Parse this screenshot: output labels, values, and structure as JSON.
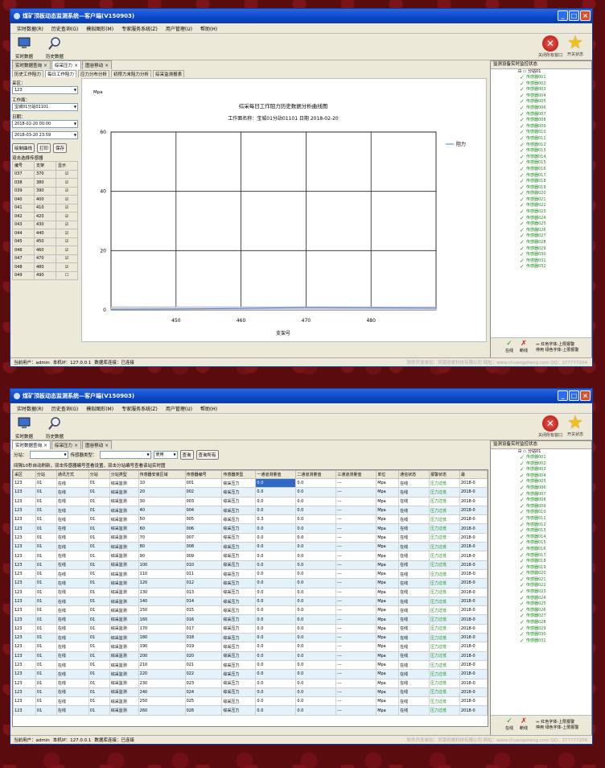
{
  "app": {
    "title": "煤矿顶板动态监测系统—客户端(V150903)",
    "menu": [
      "实时数据(R)",
      "历史查询(G)",
      "模拟图形(M)",
      "专家服务系统(Z)",
      "用户管理(U)",
      "帮助(H)"
    ],
    "toolbar": {
      "realtime": "实时数据",
      "history": "历史数据",
      "close_win": "关闭所有窗口",
      "switch_status": "开关状态"
    }
  },
  "status": {
    "user": "当前用户：admin",
    "ip": "本机IP：127.0.0.1",
    "db": "数据库连接：已连接",
    "faded": "软件开发单位：河南创晟科技有限公司  网址：www.chuangsheng.com  QQ：377777204"
  },
  "right_panel": {
    "title": "监测设备实时监控状态",
    "node": "分站01",
    "sensors": [
      "传感器001",
      "传感器002",
      "传感器003",
      "传感器004",
      "传感器005",
      "传感器006",
      "传感器007",
      "传感器008",
      "传感器009",
      "传感器010",
      "传感器011",
      "传感器012",
      "传感器013",
      "传感器014",
      "传感器015",
      "传感器016",
      "传感器017",
      "传感器018",
      "传感器019",
      "传感器020",
      "传感器021",
      "传感器022",
      "传感器023",
      "传感器024",
      "传感器025",
      "传感器026",
      "传感器027",
      "传感器028",
      "传感器029",
      "传感器030",
      "传感器031",
      "传感器032"
    ],
    "legend": {
      "online": "在线",
      "offline": "断线",
      "stop": "停用",
      "red_text": "红色字体-上限报警",
      "green_text": "绿色字体-上限报警"
    }
  },
  "window1": {
    "tabs": [
      "实时数据查询",
      "综采压力",
      "图谷移动"
    ],
    "subtabs": [
      "历史工作阻力",
      "每日工作阻力",
      "应力分布分析",
      "初撑力末阻力分析",
      "综采监测报表"
    ],
    "sidebar": {
      "area_label": "采区：",
      "area_value": "123",
      "face_label": "工作面：",
      "face_value": "宝城01分站01101",
      "date_label": "日期：",
      "date_from": "2018-02-20 00:00",
      "date_to": "2018-03-20 23:59",
      "btn_draw": "绘制曲线",
      "btn_print": "打印",
      "btn_save": "保存",
      "hint": "双击选择传感器",
      "cols": [
        "编号",
        "支架",
        "显示"
      ],
      "rows": [
        [
          "037",
          "370",
          true
        ],
        [
          "038",
          "380",
          true
        ],
        [
          "039",
          "390",
          true
        ],
        [
          "040",
          "400",
          true
        ],
        [
          "041",
          "410",
          true
        ],
        [
          "042",
          "420",
          true
        ],
        [
          "043",
          "430",
          true
        ],
        [
          "044",
          "440",
          true
        ],
        [
          "045",
          "450",
          true
        ],
        [
          "046",
          "460",
          true
        ],
        [
          "047",
          "470",
          true
        ],
        [
          "048",
          "480",
          true
        ],
        [
          "049",
          "490",
          false
        ]
      ]
    }
  },
  "chart_data": {
    "type": "line",
    "title": "综采每日工作阻力历史数据分析曲线图",
    "subtitle": "工作面名称：宝城01分站01101 日期 2018-02-20",
    "ylabel": "Mpa",
    "xlabel": "支架号",
    "ylim": [
      0,
      60
    ],
    "yticks": [
      0,
      20,
      40,
      60
    ],
    "xlim": [
      440,
      490
    ],
    "xticks": [
      450,
      460,
      470,
      480
    ],
    "series": [
      {
        "name": "阻力",
        "x": [
          440,
          450,
          460,
          470,
          480,
          490
        ],
        "y": [
          0.2,
          0.3,
          0.5,
          0.8,
          0.7,
          0.6
        ],
        "color": "#4a7bd8"
      }
    ],
    "grid": true,
    "legend": "right"
  },
  "window2": {
    "tabs": [
      "实时数据查询",
      "综采压力",
      "图谷移动"
    ],
    "filter": {
      "station_label": "分站：",
      "type_label": "传感器类型：",
      "use_value": "使用",
      "btn_query": "查询",
      "btn_query_all": "查询所有"
    },
    "note": "间隔10秒自动刷新，双击传感器编号查看设置，双击分站编号查看该站实时图",
    "columns": [
      "采区",
      "分站",
      "通讯方式",
      "分站",
      "分站类型",
      "传感器安装区域",
      "传感器编号",
      "传感器类型",
      "一通道测量值",
      "二通道测量值",
      "三通道测量值",
      "单位",
      "通信状态",
      "报警状态",
      "最"
    ],
    "rows": [
      [
        "123",
        "01",
        "在线",
        "01",
        "综采监测",
        "10",
        "001",
        "综采压力",
        "0.0",
        "0.0",
        "---",
        "Mpa",
        "在线",
        "压力过低",
        "2018-0"
      ],
      [
        "123",
        "01",
        "在线",
        "01",
        "综采监测",
        "20",
        "002",
        "综采压力",
        "0.0",
        "0.0",
        "---",
        "Mpa",
        "在线",
        "压力过低",
        "2018-0"
      ],
      [
        "123",
        "01",
        "在线",
        "01",
        "综采监测",
        "30",
        "003",
        "综采压力",
        "0.0",
        "0.0",
        "---",
        "Mpa",
        "在线",
        "压力过低",
        "2018-0"
      ],
      [
        "123",
        "01",
        "在线",
        "01",
        "综采监测",
        "40",
        "004",
        "综采压力",
        "0.0",
        "0.0",
        "---",
        "Mpa",
        "在线",
        "压力过低",
        "2018-0"
      ],
      [
        "123",
        "01",
        "在线",
        "01",
        "综采监测",
        "50",
        "005",
        "综采压力",
        "0.3",
        "0.0",
        "---",
        "Mpa",
        "在线",
        "压力过低",
        "2018-0"
      ],
      [
        "123",
        "01",
        "在线",
        "01",
        "综采监测",
        "60",
        "006",
        "综采压力",
        "0.0",
        "0.0",
        "---",
        "Mpa",
        "在线",
        "压力过低",
        "2018-0"
      ],
      [
        "123",
        "01",
        "在线",
        "01",
        "综采监测",
        "70",
        "007",
        "综采压力",
        "0.0",
        "0.0",
        "---",
        "Mpa",
        "在线",
        "压力过低",
        "2018-0"
      ],
      [
        "123",
        "01",
        "在线",
        "01",
        "综采监测",
        "80",
        "008",
        "综采压力",
        "0.0",
        "0.0",
        "---",
        "Mpa",
        "在线",
        "压力过低",
        "2018-0"
      ],
      [
        "123",
        "01",
        "在线",
        "01",
        "综采监测",
        "90",
        "009",
        "综采压力",
        "0.0",
        "0.0",
        "---",
        "Mpa",
        "在线",
        "压力过低",
        "2018-0"
      ],
      [
        "123",
        "01",
        "在线",
        "01",
        "综采监测",
        "100",
        "010",
        "综采压力",
        "0.0",
        "0.0",
        "---",
        "Mpa",
        "在线",
        "压力过低",
        "2018-0"
      ],
      [
        "123",
        "01",
        "在线",
        "01",
        "综采监测",
        "110",
        "011",
        "综采压力",
        "0.0",
        "0.0",
        "---",
        "Mpa",
        "在线",
        "压力过低",
        "2018-0"
      ],
      [
        "123",
        "01",
        "在线",
        "01",
        "综采监测",
        "120",
        "012",
        "综采压力",
        "0.0",
        "0.0",
        "---",
        "Mpa",
        "在线",
        "压力过低",
        "2018-0"
      ],
      [
        "123",
        "01",
        "在线",
        "01",
        "综采监测",
        "130",
        "013",
        "综采压力",
        "0.0",
        "0.0",
        "---",
        "Mpa",
        "在线",
        "压力过低",
        "2018-0"
      ],
      [
        "123",
        "01",
        "在线",
        "01",
        "综采监测",
        "140",
        "014",
        "综采压力",
        "0.0",
        "0.0",
        "---",
        "Mpa",
        "在线",
        "压力过低",
        "2018-0"
      ],
      [
        "123",
        "01",
        "在线",
        "01",
        "综采监测",
        "150",
        "015",
        "综采压力",
        "0.0",
        "0.0",
        "---",
        "Mpa",
        "在线",
        "压力过低",
        "2018-0"
      ],
      [
        "123",
        "01",
        "在线",
        "01",
        "综采监测",
        "160",
        "016",
        "综采压力",
        "0.0",
        "0.0",
        "---",
        "Mpa",
        "在线",
        "压力过低",
        "2018-0"
      ],
      [
        "123",
        "01",
        "在线",
        "01",
        "综采监测",
        "170",
        "017",
        "综采压力",
        "0.0",
        "0.0",
        "---",
        "Mpa",
        "在线",
        "压力过低",
        "2018-0"
      ],
      [
        "123",
        "01",
        "在线",
        "01",
        "综采监测",
        "180",
        "018",
        "综采压力",
        "0.0",
        "0.0",
        "---",
        "Mpa",
        "在线",
        "压力过低",
        "2018-0"
      ],
      [
        "123",
        "01",
        "在线",
        "01",
        "综采监测",
        "190",
        "019",
        "综采压力",
        "0.0",
        "0.0",
        "---",
        "Mpa",
        "在线",
        "压力过低",
        "2018-0"
      ],
      [
        "123",
        "01",
        "在线",
        "01",
        "综采监测",
        "200",
        "020",
        "综采压力",
        "0.0",
        "0.0",
        "---",
        "Mpa",
        "在线",
        "压力过低",
        "2018-0"
      ],
      [
        "123",
        "01",
        "在线",
        "01",
        "综采监测",
        "210",
        "021",
        "综采压力",
        "0.0",
        "0.0",
        "---",
        "Mpa",
        "在线",
        "压力过低",
        "2018-0"
      ],
      [
        "123",
        "01",
        "在线",
        "01",
        "综采监测",
        "220",
        "022",
        "综采压力",
        "0.0",
        "0.0",
        "---",
        "Mpa",
        "在线",
        "压力过低",
        "2018-0"
      ],
      [
        "123",
        "01",
        "在线",
        "01",
        "综采监测",
        "230",
        "023",
        "综采压力",
        "0.0",
        "0.0",
        "---",
        "Mpa",
        "在线",
        "压力过低",
        "2018-0"
      ],
      [
        "123",
        "01",
        "在线",
        "01",
        "综采监测",
        "240",
        "024",
        "综采压力",
        "0.0",
        "0.0",
        "---",
        "Mpa",
        "在线",
        "压力过低",
        "2018-0"
      ],
      [
        "123",
        "01",
        "在线",
        "01",
        "综采监测",
        "250",
        "025",
        "综采压力",
        "0.0",
        "0.0",
        "---",
        "Mpa",
        "在线",
        "压力过低",
        "2018-0"
      ],
      [
        "123",
        "01",
        "在线",
        "01",
        "综采监测",
        "260",
        "026",
        "综采压力",
        "0.0",
        "0.0",
        "---",
        "Mpa",
        "在线",
        "压力过低",
        "2018-0"
      ]
    ]
  }
}
